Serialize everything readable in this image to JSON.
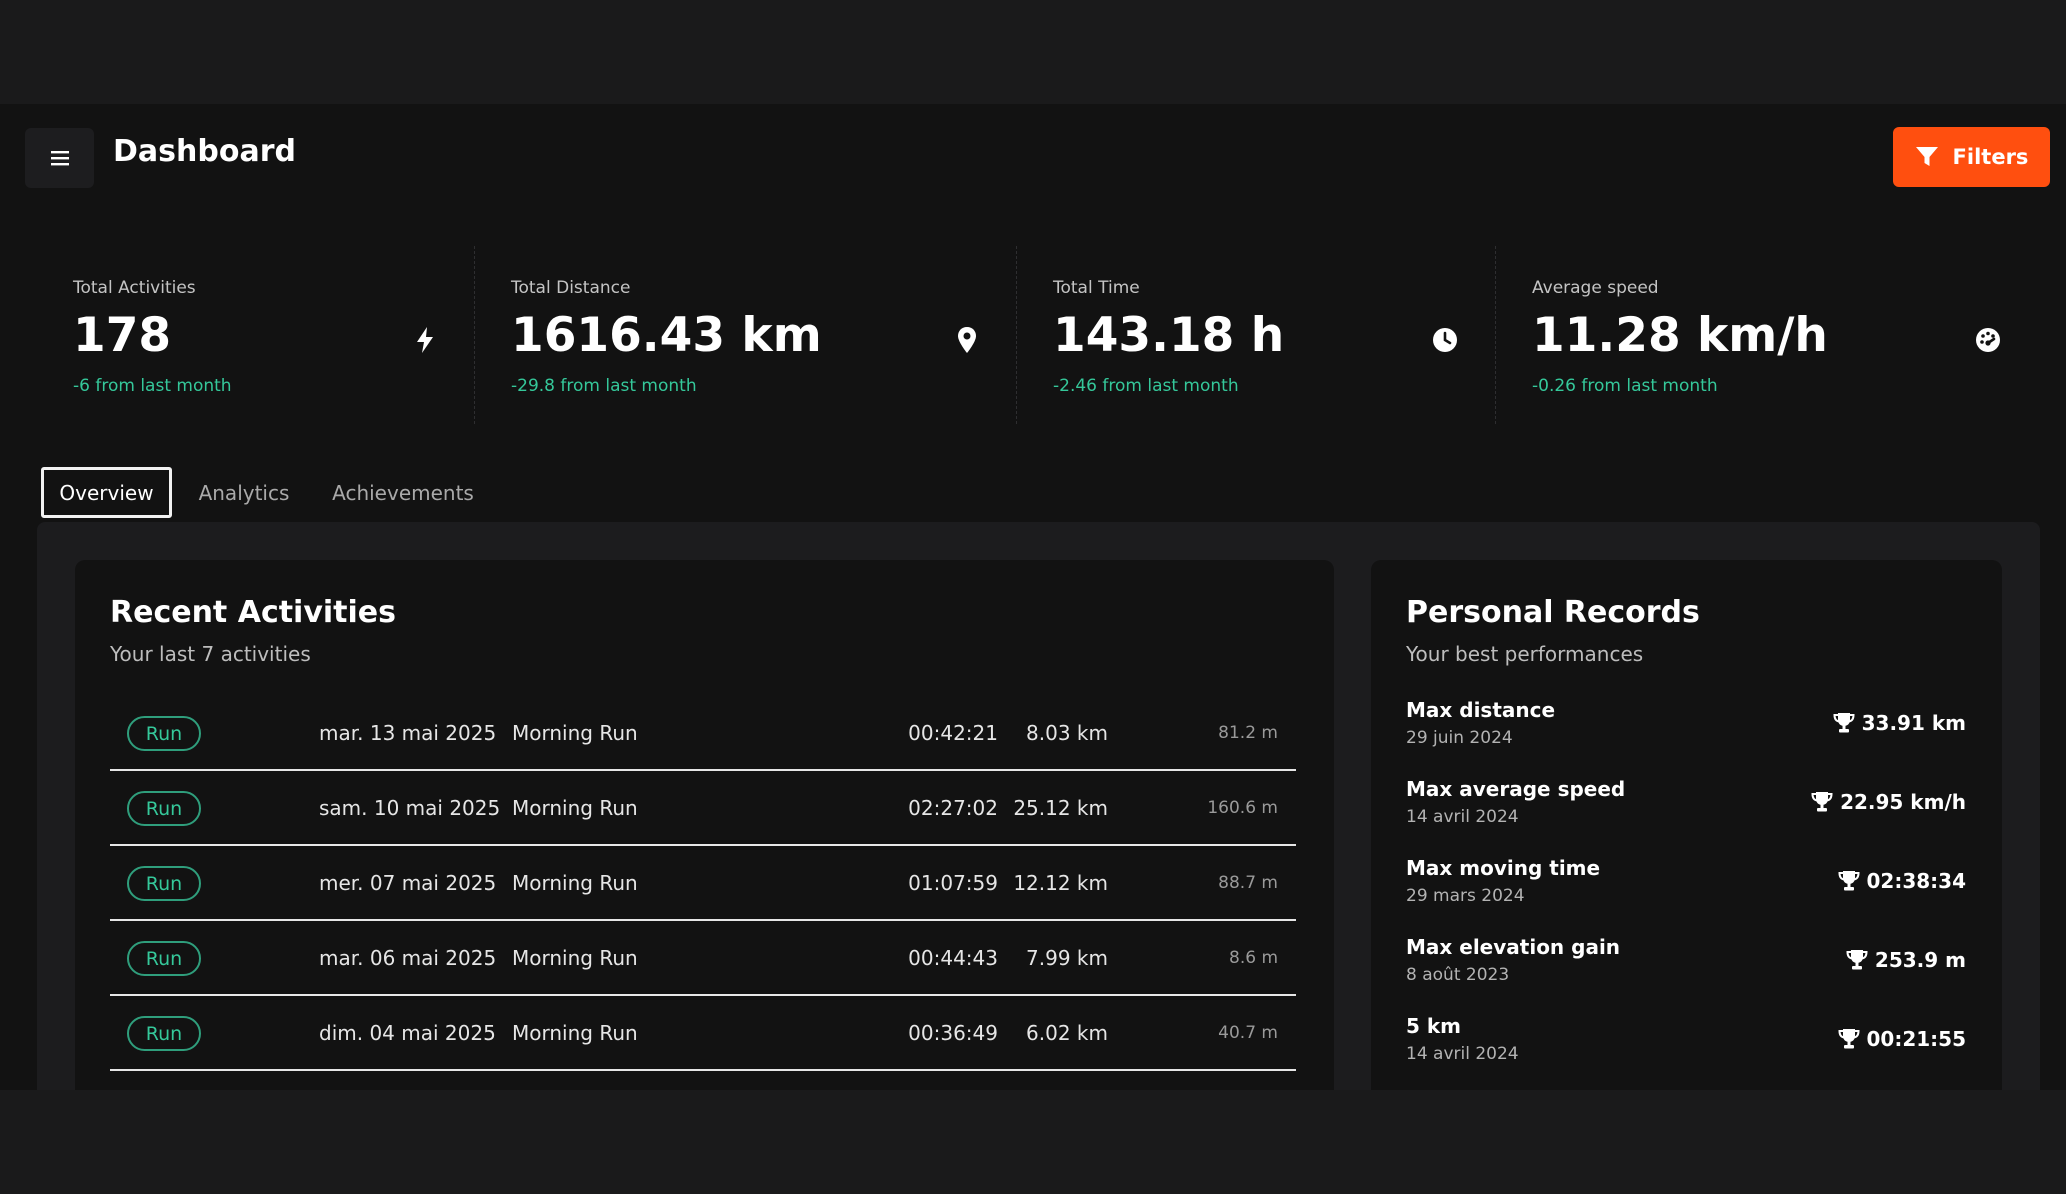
{
  "header": {
    "title": "Dashboard",
    "filters_label": "Filters"
  },
  "stats": [
    {
      "label": "Total Activities",
      "value": "178",
      "change": "-6 from last month",
      "icon": "bolt-icon"
    },
    {
      "label": "Total Distance",
      "value": "1616.43 km",
      "change": "-29.8 from last month",
      "icon": "map-pin-icon"
    },
    {
      "label": "Total Time",
      "value": "143.18 h",
      "change": "-2.46 from last month",
      "icon": "clock-icon"
    },
    {
      "label": "Average speed",
      "value": "11.28 km/h",
      "change": "-0.26 from last month",
      "icon": "speedometer-icon"
    }
  ],
  "tabs": [
    {
      "label": "Overview",
      "active": true
    },
    {
      "label": "Analytics",
      "active": false
    },
    {
      "label": "Achievements",
      "active": false
    }
  ],
  "recent": {
    "title": "Recent Activities",
    "subtitle": "Your last 7 activities",
    "rows": [
      {
        "type": "Run",
        "date": "mar. 13 mai 2025",
        "name": "Morning Run",
        "time": "00:42:21",
        "distance": "8.03 km",
        "elevation": "81.2 m"
      },
      {
        "type": "Run",
        "date": "sam. 10 mai 2025",
        "name": "Morning Run",
        "time": "02:27:02",
        "distance": "25.12 km",
        "elevation": "160.6 m"
      },
      {
        "type": "Run",
        "date": "mer. 07 mai 2025",
        "name": "Morning Run",
        "time": "01:07:59",
        "distance": "12.12 km",
        "elevation": "88.7 m"
      },
      {
        "type": "Run",
        "date": "mar. 06 mai 2025",
        "name": "Morning Run",
        "time": "00:44:43",
        "distance": "7.99 km",
        "elevation": "8.6 m"
      },
      {
        "type": "Run",
        "date": "dim. 04 mai 2025",
        "name": "Morning Run",
        "time": "00:36:49",
        "distance": "6.02 km",
        "elevation": "40.7 m"
      }
    ]
  },
  "records": {
    "title": "Personal Records",
    "subtitle": "Your best performances",
    "items": [
      {
        "title": "Max distance",
        "date": "29 juin 2024",
        "value": "33.91 km"
      },
      {
        "title": "Max average speed",
        "date": "14 avril 2024",
        "value": "22.95 km/h"
      },
      {
        "title": "Max moving time",
        "date": "29 mars 2024",
        "value": "02:38:34"
      },
      {
        "title": "Max elevation gain",
        "date": "8 août 2023",
        "value": "253.9 m"
      },
      {
        "title": "5 km",
        "date": "14 avril 2024",
        "value": "00:21:55"
      }
    ]
  },
  "colors": {
    "accent": "#ff4f0f",
    "positive": "#35c89a",
    "background": "#121212"
  }
}
